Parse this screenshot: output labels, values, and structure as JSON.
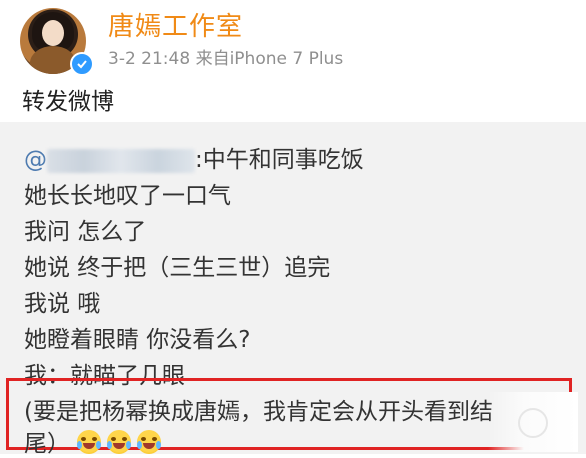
{
  "post": {
    "username": "唐嫣工作室",
    "date": "3-2 21:48",
    "source": "来自iPhone 7 Plus",
    "repost_text": "转发微博"
  },
  "quote": {
    "at_prefix": "@",
    "first_line_text": ":中午和同事吃饭",
    "lines": [
      "她长长地叹了一口气",
      "我问 怎么了",
      "她说 终于把（三生三世）追完",
      "我说 哦",
      "她瞪着眼睛 你没看么?",
      "我：就瞄了几眼"
    ],
    "highlight_line_1": "(要是把杨幂换成唐嫣，我肯定会从开头看到结",
    "highlight_line_2": "尾）"
  },
  "colors": {
    "username": "#f08a16",
    "meta": "#8f8f8f",
    "quote_bg": "#f2f2f2",
    "highlight_border": "#e02323",
    "verify_badge": "#2f9bff",
    "mention": "#4e7bb0"
  },
  "icons": {
    "avatar": "profile-photo",
    "verify": "verified-badge-icon",
    "emoji": "laugh-cry-emoji"
  }
}
